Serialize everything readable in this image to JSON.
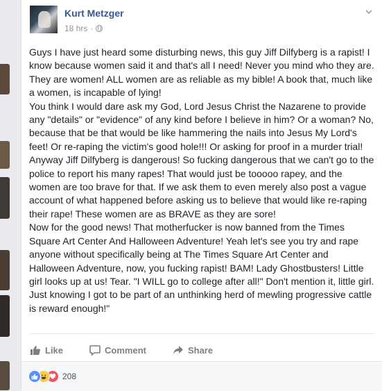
{
  "post": {
    "author": "Kurt Metzger",
    "timestamp": "18 hrs",
    "separator": "·",
    "privacy_icon": "globe-icon",
    "menu_icon": "chevron-down-icon",
    "paragraphs": [
      "Guys I have just heard some disturbing news, this guy Jiff Dilfyberg is a rapist! I know because women said it and that's all I need! Never you mind who they are. They are women! ALL women are as reliable as my bible! A book that, much like a women, is incapable of lying!",
      "You think I would dare ask my God, Lord Jesus Christ the Nazarene to provide any \"details\" or \"evidence\" of any kind before I believe in him? Or a woman? No, because that be that would be like hammering the nails into Jesus My Lord's feet! Or re-raping the victim's good hole!!! Or asking for proof in a murder trial!",
      "Anyway Jiff Dilfyberg is dangerous! So fucking dangerous that we can't go to the police to report his many rapes! That would just be tooooo rapey, and the women are too brave for that. If we ask them to even merely also post a vague account of what happened before asking us to believe that would like re-raping their rape! These women are as BRAVE as they are sore!",
      "Now for the good news! That motherfucker is now banned from the Times Square Art Center And Halloween Adventure! Yeah let's see you try and rape anyone without specifically being at The Times Square Art Center and Halloween Adventure, now, you fucking rapist! BAM! Lady Ghostbusters! Little girl looks up at us! Tear. \"I WILL go to college after all!\" Don't mention it, little girl. Just knowing I got to be part of an unthinking herd of mewling progressive cattle is reward enough!\""
    ]
  },
  "actions": {
    "like": "Like",
    "comment": "Comment",
    "share": "Share"
  },
  "reactions": {
    "types": [
      "like-reaction-icon",
      "haha-reaction-icon",
      "love-reaction-icon"
    ],
    "count": "208"
  },
  "colors": {
    "author": "#365899",
    "meta": "#90949c",
    "like_blue": "#5890ff",
    "love_red": "#f25268",
    "haha_yellow": "#f7c94d"
  }
}
